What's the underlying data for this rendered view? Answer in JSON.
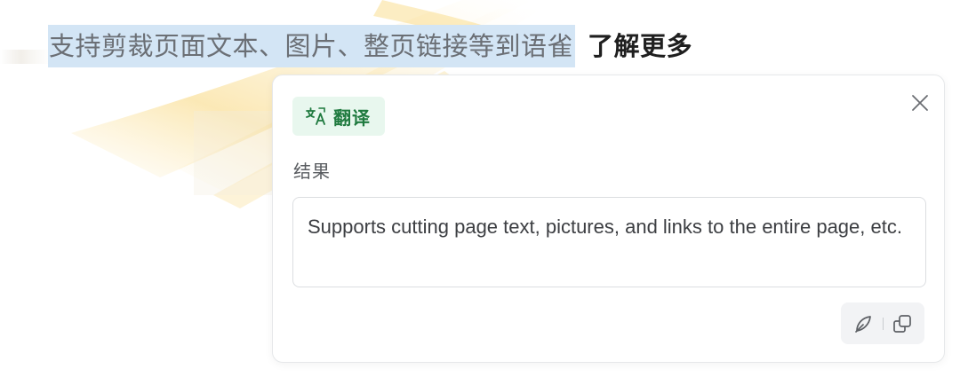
{
  "headline": {
    "selected_text": "支持剪裁页面文本、图片、整页链接等到语雀",
    "learn_more": "了解更多"
  },
  "panel": {
    "tag": {
      "icon": "translate-icon",
      "label": "翻译"
    },
    "result_label": "结果",
    "result_text": "Supports cutting page text, pictures, and links to the entire page, etc.",
    "toolbar": {
      "edit_icon": "feather-pen-icon",
      "copy_icon": "copy-icon"
    },
    "close_icon": "close-icon"
  },
  "colors": {
    "selection": "#d3e5f5",
    "tag_bg": "#e8f7ee",
    "tag_fg": "#1f7a3f",
    "brush": "#f7c948"
  }
}
